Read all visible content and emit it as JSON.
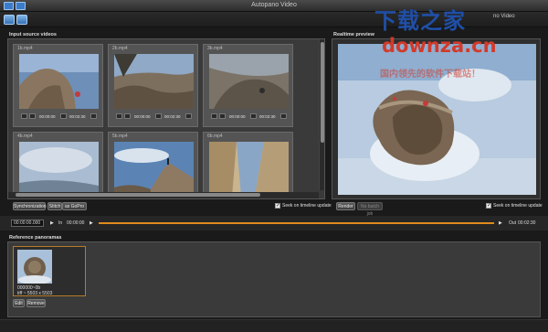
{
  "window": {
    "title": "Autopano Video"
  },
  "input_panel": {
    "title": "Input source videos",
    "clips": [
      {
        "name": "1b.mp4",
        "start": "00:00:00",
        "end": "00:02:30"
      },
      {
        "name": "2b.mp4",
        "start": "00:00:00",
        "end": "00:02:30"
      },
      {
        "name": "3b.mp4",
        "start": "00:00:00",
        "end": "00:02:30"
      },
      {
        "name": "4b.mp4"
      },
      {
        "name": "5b.mp4"
      },
      {
        "name": "6b.mp4"
      }
    ],
    "sync_label": "Synchronization",
    "stitch_label": "Stitch",
    "stitch_as_label": "as GoPro",
    "seek_label": "Seek on timeline update"
  },
  "preview_panel": {
    "title": "Realtime preview",
    "render_label": "Render",
    "batch_label": "No batch job",
    "seek_label": "Seek on timeline update"
  },
  "timeline": {
    "current": "00:00:00.000",
    "in_label": "In",
    "in_value": "00:00:00",
    "out_label": "Out",
    "out_value": "00:02:30",
    "range_fill": 1.0
  },
  "reference": {
    "title": "Reference panoramas",
    "item_name": "000000~0b",
    "item_size": "tiff ~ 5503 x 5503",
    "edit_label": "Edit",
    "remove_label": "Remove"
  },
  "watermark": {
    "line1": "下载之家",
    "line2": "downza.cn",
    "line3": "国内领先的软件下载站！",
    "partial": "no Video"
  },
  "colors": {
    "accent": "#e08a1c",
    "watermark_blue": "#1f4fa8",
    "watermark_red": "#d23a2a"
  }
}
